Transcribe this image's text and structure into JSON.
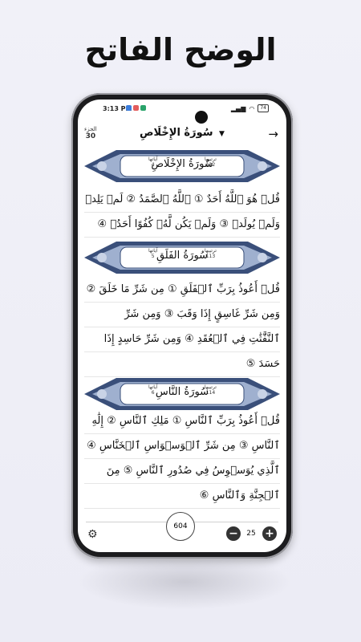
{
  "headline": "الوضح الفاتح",
  "status": {
    "time": "3:13 PM",
    "battery": "74"
  },
  "header": {
    "juz_label": "الجزء",
    "juz_number": "30",
    "surah_title": "سُورَةُ الإِخْلَاصِ",
    "dropdown_icon": "caret-down-icon",
    "back_icon": "arrow-right-icon"
  },
  "surahs": [
    {
      "name": "سُورَةُ الإِخْلَاصِ",
      "order_label": "ترتيبها",
      "order": "112",
      "verses_label": "آياتها",
      "verses": "4",
      "lines": [
        "قُلۡ هُوَ ٱللَّهُ أَحَدٌ ① ٱللَّهُ ٱلصَّمَدُ ② لَمۡ يَلِدۡ",
        "وَلَمۡ يُولَدۡ ③ وَلَمۡ يَكُن لَّهُۥ كُفُوًا أَحَدُۢ ④"
      ]
    },
    {
      "name": "سُورَةُ الفَلَقِ",
      "order_label": "ترتيبها",
      "order": "113",
      "verses_label": "آياتها",
      "verses": "5",
      "lines": [
        "قُلۡ أَعُوذُ بِرَبِّ ٱلۡفَلَقِ ① مِن شَرِّ مَا خَلَقَ ②",
        "وَمِن شَرِّ غَاسِقٍ إِذَا وَقَبَ ③ وَمِن شَرِّ",
        "ٱلنَّفَّٰثَٰتِ فِي ٱلۡعُقَدِ ④ وَمِن شَرِّ حَاسِدٍ إِذَا",
        "حَسَدَ ⑤"
      ]
    },
    {
      "name": "سُورَةُ النَّاسِ",
      "order_label": "ترتيبها",
      "order": "114",
      "verses_label": "آياتها",
      "verses": "6",
      "lines": [
        "قُلۡ أَعُوذُ بِرَبِّ ٱلنَّاسِ ① مَلِكِ ٱلنَّاسِ ② إِلَٰهِ",
        "ٱلنَّاسِ ③ مِن شَرِّ ٱلۡوَسۡوَاسِ ٱلۡخَنَّاسِ ④",
        "ٱلَّذِي يُوَسۡوِسُ فِي صُدُورِ ٱلنَّاسِ ⑤ مِنَ",
        "ٱلۡجِنَّةِ وَٱلنَّاسِ ⑥"
      ]
    }
  ],
  "bottom": {
    "page_number": "604",
    "font_size": "25",
    "settings_icon": "gear-icon",
    "minus": "−",
    "plus": "+"
  },
  "colors": {
    "ornament": "#3a4f7a",
    "ornament_light": "#c9d3e6"
  }
}
